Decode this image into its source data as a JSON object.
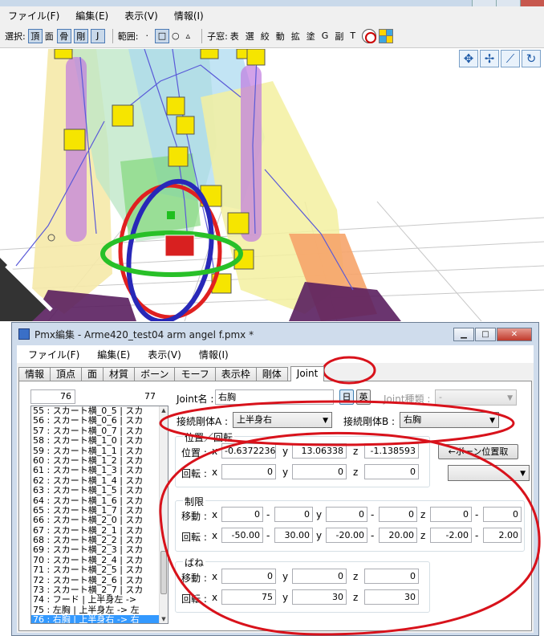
{
  "bg_window": {
    "menu": [
      "ファイル(F)",
      "編集(E)",
      "表示(V)",
      "情報(I)"
    ],
    "toolbar": {
      "select_label": "選択:",
      "select_buttons": [
        "頂",
        "面",
        "骨",
        "剛",
        "J"
      ],
      "range_label": "範囲:",
      "range_buttons": [
        "·",
        "□",
        "○",
        "▵"
      ],
      "subwin_label": "子窓:",
      "subwin_items": [
        "表",
        "選",
        "絞",
        "動",
        "拡",
        "塗",
        "G",
        "副",
        "T"
      ]
    },
    "view_tools": [
      "move-cross-icon",
      "move-axes-icon",
      "bone-tool-icon",
      "rotate-icon"
    ]
  },
  "editor": {
    "title": "Pmx編集 - Arme420_test04 arm angel f.pmx *",
    "menu": [
      "ファイル(F)",
      "編集(E)",
      "表示(V)",
      "情報(I)"
    ],
    "tabs": [
      "情報",
      "頂点",
      "面",
      "材質",
      "ボーン",
      "モーフ",
      "表示枠",
      "剛体",
      "Joint"
    ],
    "active_tab": "Joint",
    "index_value": "76",
    "count": "77",
    "list_items": [
      "55 : スカート横_0_5 | スカ",
      "56 : スカート横_0_6 | スカ",
      "57 : スカート横_0_7 | スカ",
      "58 : スカート横_1_0 | スカ",
      "59 : スカート横_1_1 | スカ",
      "60 : スカート横_1_2 | スカ",
      "61 : スカート横_1_3 | スカ",
      "62 : スカート横_1_4 | スカ",
      "63 : スカート横_1_5 | スカ",
      "64 : スカート横_1_6 | スカ",
      "65 : スカート横_1_7 | スカ",
      "66 : スカート横_2_0 | スカ",
      "67 : スカート横_2_1 | スカ",
      "68 : スカート横_2_2 | スカ",
      "69 : スカート横_2_3 | スカ",
      "70 : スカート横_2_4 | スカ",
      "71 : スカート横_2_5 | スカ",
      "72 : スカート横_2_6 | スカ",
      "73 : スカート横_2_7 | スカ",
      "74 : フード | 上半身左 ->",
      "75 : 左胸 | 上半身左 -> 左",
      "76 : 右胸 | 上半身右 -> 右"
    ],
    "selected_index": 21,
    "joint": {
      "name_label": "Joint名 :",
      "name_value": "右胸",
      "lang_jp": "日",
      "lang_en": "英",
      "type_label": "Joint種類 :",
      "type_value": "-",
      "body_a_label": "接続剛体A :",
      "body_a_value": "上半身右",
      "body_b_label": "接続剛体B :",
      "body_b_value": "右胸",
      "pos_rot_title": "位置／回転",
      "pos_label": "位置 :",
      "rot_label": "回転 :",
      "x": "x",
      "y": "y",
      "z": "z",
      "pos": [
        "-0.6372236",
        "13.06338",
        "-1.138593"
      ],
      "rot": [
        "0",
        "0",
        "0"
      ],
      "bone_pos_button": "←ボーン位置取",
      "limit_title": "制限",
      "move_label": "移動 :",
      "limit_rot_label": "回転 :",
      "move_limits": [
        [
          "0",
          "0"
        ],
        [
          "0",
          "0"
        ],
        [
          "0",
          "0"
        ]
      ],
      "rot_limits": [
        [
          "-50.00",
          "30.00"
        ],
        [
          "-20.00",
          "20.00"
        ],
        [
          "-2.00",
          "2.00"
        ]
      ],
      "spring_title": "ばね",
      "spring_move_label": "移動 :",
      "spring_rot_label": "回転 :",
      "spring_move": [
        "0",
        "0",
        "0"
      ],
      "spring_rot": [
        "75",
        "30",
        "30"
      ],
      "dash": "-"
    }
  }
}
